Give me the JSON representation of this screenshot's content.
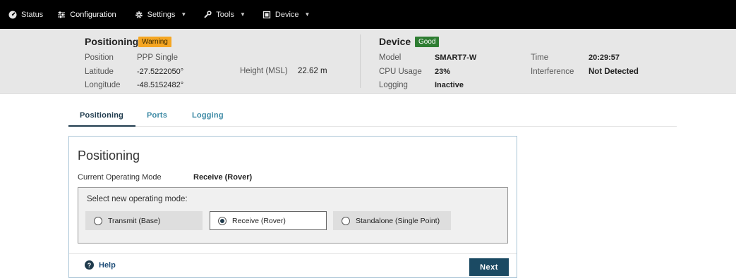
{
  "nav": {
    "items": [
      {
        "label": "Status",
        "icon": "dashboard-icon"
      },
      {
        "label": "Configuration",
        "icon": "sliders-icon"
      },
      {
        "label": "Settings",
        "icon": "gear-icon"
      },
      {
        "label": "Tools",
        "icon": "wrench-icon"
      },
      {
        "label": "Device",
        "icon": "device-icon"
      }
    ]
  },
  "positioning": {
    "title": "Positioning",
    "badge": "Warning",
    "position_label": "Position",
    "position_value": "PPP  Single",
    "latitude_label": "Latitude",
    "latitude_value": "-27.5222050°",
    "longitude_label": "Longitude",
    "longitude_value": "-48.5152482°",
    "height_label": "Height (MSL)",
    "height_value": "22.62 m"
  },
  "device": {
    "title": "Device",
    "badge": "Good",
    "model_label": "Model",
    "model_value": "SMART7-W",
    "cpu_label": "CPU Usage",
    "cpu_value": "23%",
    "logging_label": "Logging",
    "logging_value": "Inactive",
    "time_label": "Time",
    "time_value": "20:29:57",
    "interference_label": "Interference",
    "interference_value": "Not Detected"
  },
  "tabs": [
    "Positioning",
    "Ports",
    "Logging"
  ],
  "card": {
    "title": "Positioning",
    "current_mode_label": "Current Operating Mode",
    "current_mode_value": "Receive (Rover)",
    "select_label": "Select new operating mode:",
    "options": [
      "Transmit (Base)",
      "Receive (Rover)",
      "Standalone (Single Point)"
    ],
    "selected_option": "Receive (Rover)",
    "help_label": "Help",
    "next_label": "Next"
  },
  "colors": {
    "warning": "#f5a623",
    "good": "#2e7d32",
    "primary": "#1b4a63",
    "tab_link": "#3d8aa5"
  }
}
